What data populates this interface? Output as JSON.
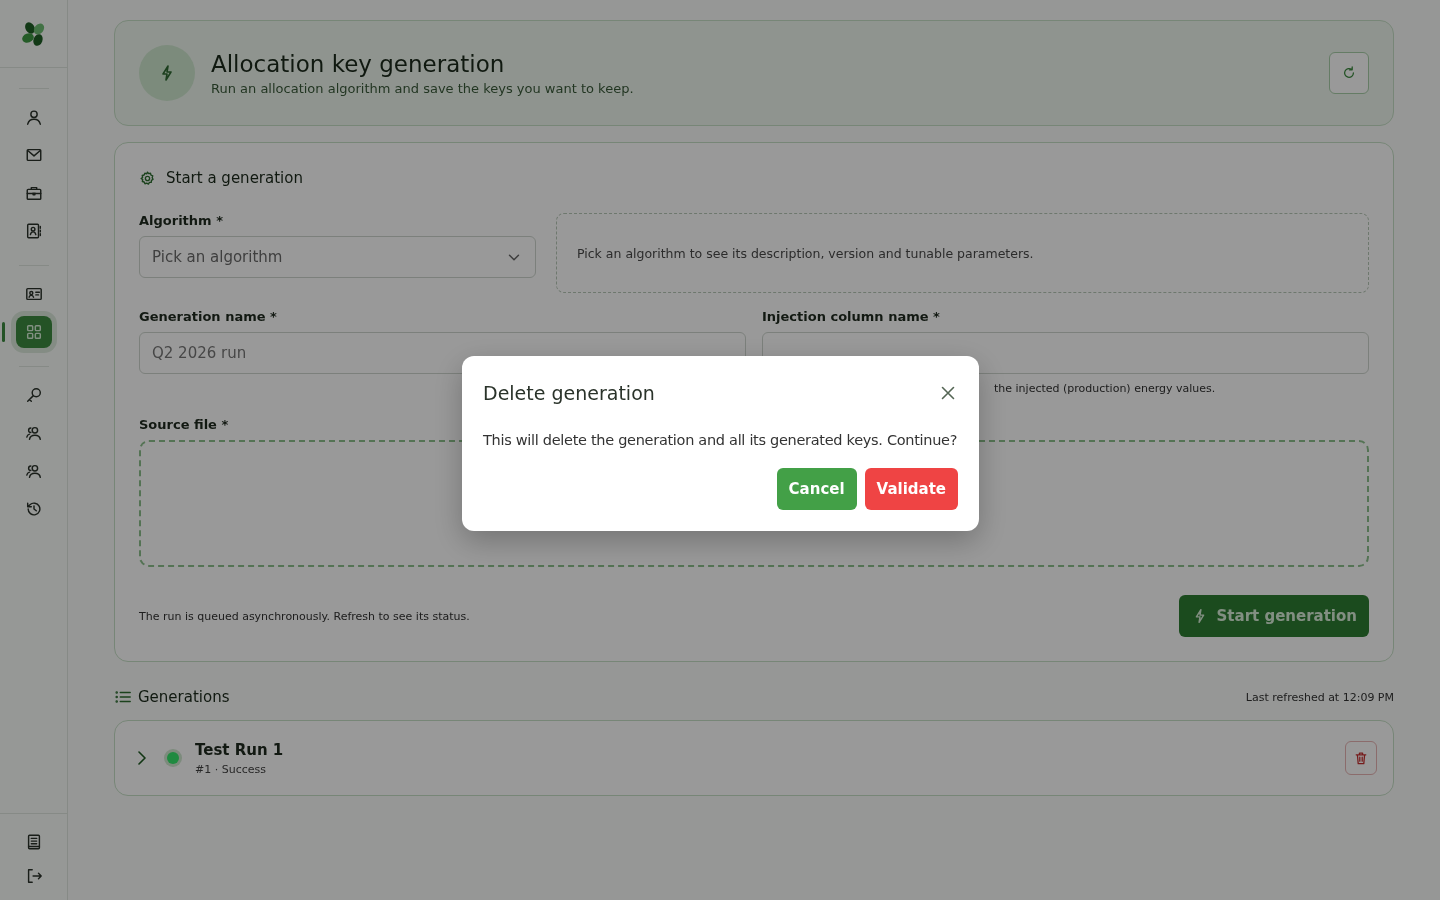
{
  "sidebar": {
    "groups": [
      [
        {
          "selected": false
        },
        {
          "selected": false
        },
        {
          "selected": false
        },
        {
          "selected": false
        }
      ],
      [
        {
          "selected": false
        },
        {
          "selected": true
        }
      ],
      [
        {
          "selected": false
        },
        {
          "selected": false
        },
        {
          "selected": false
        },
        {
          "selected": false
        }
      ]
    ],
    "bottom": [
      {
        "selected": false
      },
      {
        "selected": false
      }
    ]
  },
  "header": {
    "title": "Allocation key generation",
    "subtitle": "Run an allocation algorithm and save the keys you want to keep."
  },
  "form": {
    "title": "Start a generation",
    "algorithm": {
      "label": "Algorithm *",
      "placeholder": "Pick an algorithm"
    },
    "algorithm_info": "Pick an algorithm to see its description, version and tunable parameters.",
    "generation_name": {
      "label": "Generation name *",
      "placeholder": "Q2 2026 run"
    },
    "injection_column": {
      "label": "Injection column name *",
      "hint": "the injected (production) energy values."
    },
    "source_file": {
      "label": "Source file *"
    },
    "note": "The run is queued asynchronously. Refresh to see its status.",
    "submit": "Start generation"
  },
  "generations": {
    "title": "Generations",
    "refreshed": "Last refreshed at 12:09 PM",
    "items": [
      {
        "name": "Test Run 1",
        "meta": "#1 · Success",
        "color": "#1f8a40",
        "expanded": false
      }
    ]
  },
  "dialog": {
    "title": "Delete generation",
    "message": "This will delete the generation and all its generated keys. Continue?",
    "buttons": [
      {
        "label": "Cancel",
        "kind": "cancel"
      },
      {
        "label": "Validate",
        "kind": "confirm"
      }
    ]
  }
}
